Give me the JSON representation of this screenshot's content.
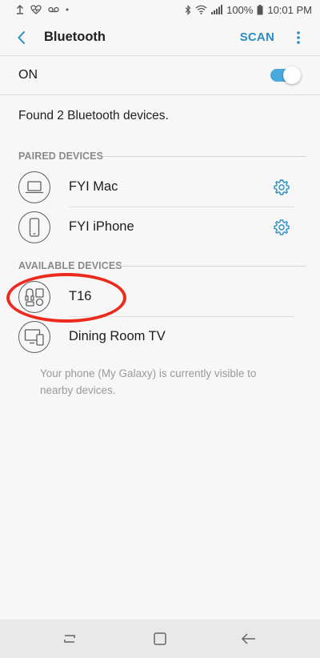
{
  "status_bar": {
    "battery": "100%",
    "time": "10:01 PM"
  },
  "app_bar": {
    "title": "Bluetooth",
    "scan_label": "SCAN",
    "back_icon": "back-arrow-icon",
    "more_icon": "more-vertical-icon"
  },
  "toggle": {
    "label": "ON",
    "state": "on",
    "accent_color": "#4aa9dc"
  },
  "found_text": "Found 2 Bluetooth devices.",
  "paired": {
    "header": "PAIRED DEVICES",
    "devices": [
      {
        "name": "FYI Mac",
        "icon": "laptop-icon",
        "settings_icon": "gear-icon"
      },
      {
        "name": "FYI iPhone",
        "icon": "phone-icon",
        "settings_icon": "gear-icon"
      }
    ]
  },
  "available": {
    "header": "AVAILABLE DEVICES",
    "devices": [
      {
        "name": "T16",
        "icon": "generic-device-icon"
      },
      {
        "name": "Dining Room TV",
        "icon": "tv-display-icon"
      }
    ]
  },
  "visibility_note": "Your phone (My Galaxy) is currently visible to nearby devices.",
  "annotation": {
    "color": "#ec2b1e"
  },
  "colors": {
    "brand": "#2a8ec6"
  }
}
